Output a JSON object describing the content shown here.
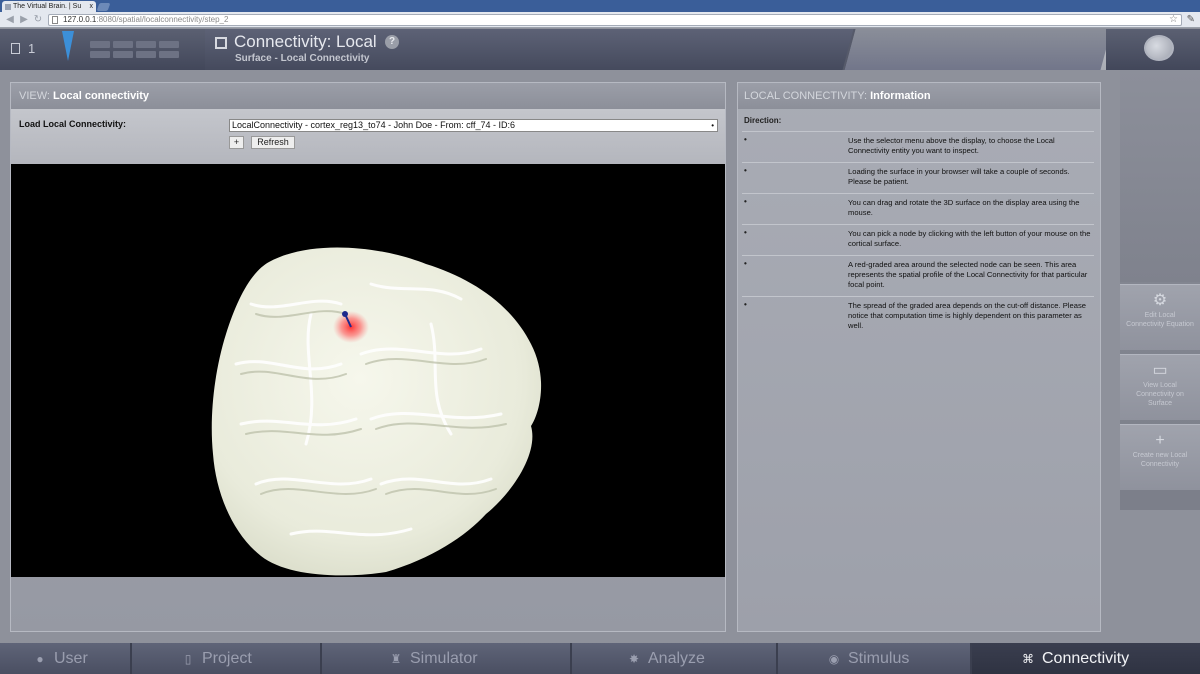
{
  "browser": {
    "tab_title": "The Virtual Brain. | Su",
    "tab_close": "x",
    "url_host": "127.0.0.1",
    "url_path": ":8080/spatial/localconnectivity/step_2"
  },
  "header": {
    "project_count": "1",
    "title": "Connectivity: Local",
    "subtitle": "Surface - Local Connectivity",
    "help": "?"
  },
  "view": {
    "title_key": "VIEW:",
    "title_value": "Local connectivity",
    "load_label": "Load Local Connectivity:",
    "selected": "LocalConnectivity - cortex_reg13_to74 - John Doe - From: cff_74 - ID:6",
    "plus_button": "+",
    "refresh_button": "Refresh"
  },
  "info": {
    "title_key": "LOCAL CONNECTIVITY:",
    "title_value": "Information",
    "direction_label": "Direction:",
    "items": [
      {
        "bullet": "•",
        "text": "Use the selector menu above the display, to choose the Local Connectivity entity you want to inspect."
      },
      {
        "bullet": "•",
        "text": "Loading the surface in your browser will take a couple of seconds. Please be patient."
      },
      {
        "bullet": "•",
        "text": "You can drag and rotate the 3D surface on the display area using the mouse."
      },
      {
        "bullet": "•",
        "text": "You can pick a node by clicking with the left button of your mouse on the cortical surface."
      },
      {
        "bullet": "•",
        "text": "A red-graded area around the selected node can be seen. This area represents the spatial profile of the Local Connectivity for that particular focal point."
      },
      {
        "bullet": "•",
        "text": "The spread of the graded area depends on the cut-off distance. Please notice that computation time is highly dependent on this parameter as well."
      }
    ]
  },
  "tools": [
    {
      "icon": "gear-icon",
      "glyph": "⚙",
      "label": "Edit Local Connectivity Equation"
    },
    {
      "icon": "monitor-icon",
      "glyph": "▭",
      "label": "View Local Connectivity on Surface"
    },
    {
      "icon": "plus-icon",
      "glyph": "+",
      "label": "Create new Local Connectivity"
    }
  ],
  "bottom_nav": [
    {
      "label": "User",
      "glyph": "●",
      "icon": "user-icon"
    },
    {
      "label": "Project",
      "glyph": "▯",
      "icon": "document-icon"
    },
    {
      "label": "Simulator",
      "glyph": "♜",
      "icon": "flask-icon"
    },
    {
      "label": "Analyze",
      "glyph": "✸",
      "icon": "burst-icon"
    },
    {
      "label": "Stimulus",
      "glyph": "◉",
      "icon": "pin-icon"
    },
    {
      "label": "Connectivity",
      "glyph": "⌘",
      "icon": "connectivity-icon"
    }
  ],
  "colors": {
    "active_nav": "#2f3342",
    "brain": "#eef0e2",
    "focal_node": "#1d2a8c",
    "focal_area": "#ff4a4a"
  }
}
